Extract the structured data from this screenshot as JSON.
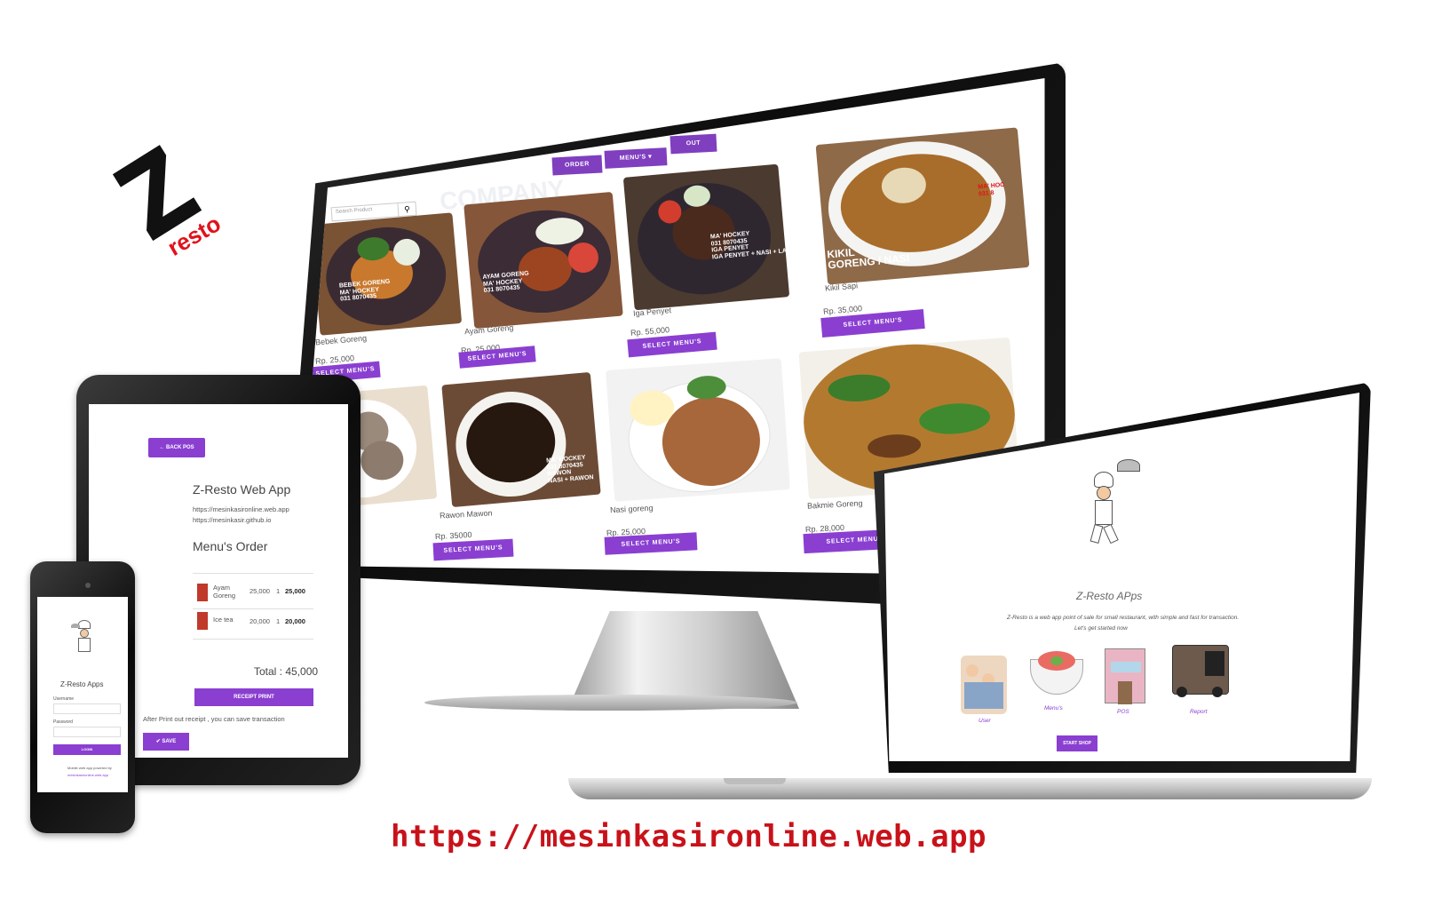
{
  "logo": {
    "letter": "Z",
    "word": "resto"
  },
  "monitor": {
    "nav": {
      "order": "ORDER",
      "menus": "MENU'S ▾",
      "out": "OUT"
    },
    "search": {
      "placeholder": "Search Product"
    },
    "watermark": "COMPANY",
    "items": [
      {
        "name": "Bebek Goreng",
        "price": "Rp. 25,000",
        "button": "SELECT MENU'S"
      },
      {
        "name": "Ayam Goreng",
        "price": "Rp. 25,000",
        "button": "SELECT MENU'S"
      },
      {
        "name": "Iga Penyet",
        "price": "Rp. 55,000",
        "button": "SELECT MENU'S"
      },
      {
        "name": "Kikil Sapi",
        "price": "Rp. 35,000",
        "button": "SELECT MENU'S"
      },
      {
        "name": "Rawon Mawon",
        "price": "Rp. 35000",
        "button": "SELECT MENU'S"
      },
      {
        "name": "Nasi goreng",
        "price": "Rp. 25,000",
        "button": "SELECT MENU'S"
      },
      {
        "name": "Bakmie Goreng",
        "price": "Rp. 28,000",
        "button": "SELECT MENU'S"
      }
    ],
    "image_captions": {
      "bebek": "BEBEK GORENG\nMA' HOCKEY\n031 8070435",
      "ayam": "AYAM GORENG\nMA' HOCKEY\n031 8070435",
      "iga": "MA' HOCKEY\n031 8070435\nIGA PENYET\nIGA PENYET + NASI + LALAPAN",
      "kikil_top": "MA' HOC\n031 8",
      "kikil_bottom": "KIKIL\nGORENG / NASI",
      "rawon": "MA' HOCKEY\n031 8070435\nRAWON\nNASI + RAWON"
    }
  },
  "tablet": {
    "back_button": "← BACK POS",
    "app_title": "Z-Resto Web App",
    "urls": [
      "https://mesinkasironline.web.app",
      "https://mesinkasir.github.io"
    ],
    "order_title": "Menu's Order",
    "rows": [
      {
        "name": "Ayam Goreng",
        "price": "25,000",
        "qty": "1",
        "total": "25,000"
      },
      {
        "name": "Ice tea",
        "price": "20,000",
        "qty": "1",
        "total": "20,000"
      }
    ],
    "total": "Total : 45,000",
    "receipt_button": "RECEIPT PRINT",
    "note": "After Print out receipt , you can save transaction",
    "save_button": "✔ SAVE"
  },
  "phone": {
    "title": "Z-Resto Apps",
    "username_label": "Username",
    "password_label": "Password",
    "login_button": "LOGIN",
    "footer_line1": "Mobile web app powered by",
    "footer_line2": "mesinkasironline.web.app"
  },
  "laptop": {
    "title": "Z-Resto APps",
    "description_line1": "Z-Resto is a web app point of sale for small restaurant, with simple and fast for transaction.",
    "description_line2": "Let's get started now",
    "features": [
      {
        "label": "User",
        "icon": "user-icon"
      },
      {
        "label": "Menu's",
        "icon": "salad-bowl-icon"
      },
      {
        "label": "POS",
        "icon": "restaurant-icon"
      },
      {
        "label": "Report",
        "icon": "food-truck-icon"
      }
    ],
    "start_button": "START SHOP"
  },
  "bottom_url": "https://mesinkasironline.web.app",
  "colors": {
    "accent": "#8a3fd1",
    "url": "#c8121a",
    "logo_red": "#e1121b"
  }
}
